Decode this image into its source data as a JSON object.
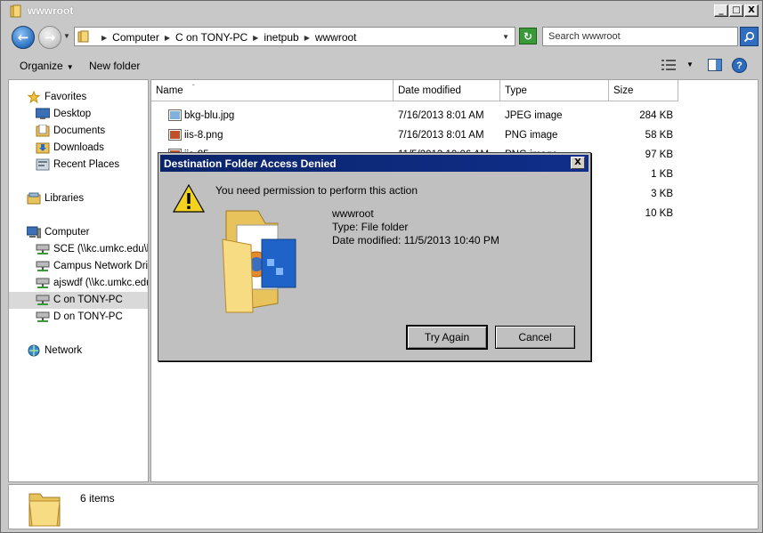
{
  "window": {
    "title": "wwwroot",
    "minimize_glyph": "_",
    "maximize_glyph": "□",
    "close_glyph": "X"
  },
  "navbar": {
    "breadcrumbs": [
      "Computer",
      "C on TONY-PC",
      "inetpub",
      "wwwroot"
    ],
    "search_placeholder": "Search wwwroot"
  },
  "toolbar": {
    "organize_label": "Organize",
    "new_folder_label": "New folder"
  },
  "sidebar": {
    "items": [
      {
        "label": "Favorites",
        "icon": "star-icon"
      },
      {
        "label": "Desktop",
        "icon": "desktop-icon"
      },
      {
        "label": "Documents",
        "icon": "documents-icon"
      },
      {
        "label": "Downloads",
        "icon": "downloads-icon"
      },
      {
        "label": "Recent Places",
        "icon": "recent-places-icon"
      },
      {
        "label": "Libraries",
        "icon": "libraries-icon"
      },
      {
        "label": "Computer",
        "icon": "computer-icon"
      },
      {
        "label": "SCE (\\\\kc.umkc.edu\\kc",
        "icon": "network-drive-icon"
      },
      {
        "label": "Campus Network Drive",
        "icon": "network-drive-icon"
      },
      {
        "label": "ajswdf (\\\\kc.umkc.edu",
        "icon": "network-drive-icon"
      },
      {
        "label": "C on TONY-PC",
        "icon": "network-drive-icon"
      },
      {
        "label": "D on TONY-PC",
        "icon": "network-drive-icon"
      },
      {
        "label": "Network",
        "icon": "network-icon"
      }
    ]
  },
  "columns": {
    "name": "Name",
    "date": "Date modified",
    "type": "Type",
    "size": "Size"
  },
  "files": [
    {
      "name": "bkg-blu.jpg",
      "date": "7/16/2013 8:01 AM",
      "type": "JPEG image",
      "size": "284 KB"
    },
    {
      "name": "iis-8.png",
      "date": "7/16/2013 8:01 AM",
      "type": "PNG image",
      "size": "58 KB"
    },
    {
      "name": "iis-85",
      "date": "11/5/2013 10:06 AM",
      "type": "PNG image",
      "size": "97 KB"
    },
    {
      "name": "",
      "date": "",
      "type": "",
      "size": "1 KB"
    },
    {
      "name": "",
      "date": "",
      "type": "",
      "size": "3 KB"
    },
    {
      "name": "",
      "date": "",
      "type": "",
      "size": "10 KB"
    }
  ],
  "status": {
    "count_text": "6 items"
  },
  "dialog": {
    "title": "Destination Folder Access Denied",
    "close_glyph": "X",
    "message": "You need permission to perform this action",
    "item_name": "wwwroot",
    "item_type": "Type: File folder",
    "item_date": "Date modified: 11/5/2013 10:40 PM",
    "try_again_label": "Try Again",
    "cancel_label": "Cancel"
  }
}
